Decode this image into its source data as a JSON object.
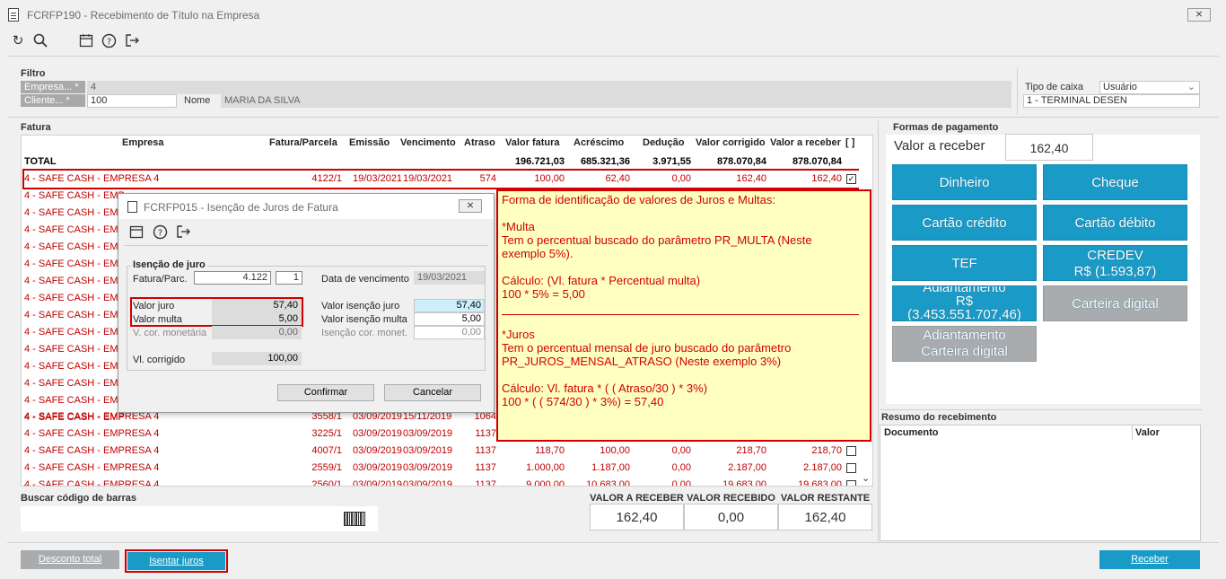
{
  "window": {
    "title": "FCRFP190 - Recebimento de Título na Empresa",
    "close": "⨯"
  },
  "filtro": {
    "section": "Filtro",
    "empresa_label": "Empresa... *",
    "empresa_value": "4",
    "cliente_label": "Cliente... *",
    "cliente_value": "100",
    "nome_label": "Nome",
    "nome_value": "MARIA DA SILVA",
    "tipo_caixa_label": "Tipo de caixa",
    "tipo_caixa_value": "Usuário",
    "terminal_value": "1 - TERMINAL DESEN"
  },
  "fatura": {
    "section": "Fatura",
    "columns": [
      "Empresa",
      "Fatura/Parcela",
      "Emissão",
      "Vencimento",
      "Atraso",
      "Valor fatura",
      "Acréscimo",
      "Dedução",
      "Valor corrigido",
      "Valor a receber",
      "[ ]"
    ],
    "total": {
      "label": "TOTAL",
      "valor_fatura": "196.721,03",
      "acrescimo": "685.321,36",
      "deducao": "3.971,55",
      "valor_corrigido": "878.070,84",
      "valor_receber": "878.070,84"
    },
    "first_row": {
      "empresa": "4 - SAFE CASH -  EMPRESA 4",
      "fatura": "4122/1",
      "emissao": "19/03/2021",
      "vencimento": "19/03/2021",
      "atraso": "574",
      "valor_fatura": "100,00",
      "acrescimo": "62,40",
      "deducao": "0,00",
      "valor_corrigido": "162,40",
      "valor_receber": "162,40",
      "checked": "✓"
    },
    "truncated_rows": [
      "4 - SAFE CASH -  EMP",
      "4 - SAFE CASH -  EMP",
      "4 - SAFE CASH -  EMP",
      "4 - SAFE CASH -  EMP",
      "4 - SAFE CASH -  EMP",
      "4 - SAFE CASH -  EMP",
      "4 - SAFE CASH -  EMP",
      "4 - SAFE CASH -  EMP",
      "4 - SAFE CASH -  EMP",
      "4 - SAFE CASH -  EMP",
      "4 - SAFE CASH -  EMP",
      "4 - SAFE CASH -  EMP",
      "4 - SAFE CASH -  EMP",
      "4 - SAFE CASH -  EMP"
    ],
    "rows": [
      {
        "empresa": "4 - SAFE CASH -  EMPRESA 4",
        "fatura": "3558/1",
        "emissao": "03/09/2019",
        "vencimento": "15/11/2019",
        "atraso": "1064"
      },
      {
        "empresa": "4 - SAFE CASH -  EMPRESA 4",
        "fatura": "3225/1",
        "emissao": "03/09/2019",
        "vencimento": "03/09/2019",
        "atraso": "1137"
      },
      {
        "empresa": "4 - SAFE CASH -  EMPRESA 4",
        "fatura": "4007/1",
        "emissao": "03/09/2019",
        "vencimento": "03/09/2019",
        "atraso": "1137",
        "valor_fatura": "118,70",
        "acrescimo": "100,00",
        "deducao": "0,00",
        "valor_corrigido": "218,70",
        "valor_receber": "218,70"
      },
      {
        "empresa": "4 - SAFE CASH -  EMPRESA 4",
        "fatura": "2559/1",
        "emissao": "03/09/2019",
        "vencimento": "03/09/2019",
        "atraso": "1137",
        "valor_fatura": "1.000,00",
        "acrescimo": "1.187,00",
        "deducao": "0,00",
        "valor_corrigido": "2.187,00",
        "valor_receber": "2.187,00"
      },
      {
        "empresa": "4 - SAFE CASH -  EMPRESA 4",
        "fatura": "2560/1",
        "emissao": "03/09/2019",
        "vencimento": "03/09/2019",
        "atraso": "1137",
        "valor_fatura": "9.000,00",
        "acrescimo": "10.683,00",
        "deducao": "0,00",
        "valor_corrigido": "19.683,00",
        "valor_receber": "19.683,00"
      }
    ]
  },
  "dialog": {
    "title": "FCRFP015 - Isenção de Juros de Fatura",
    "group": "Isenção de juro",
    "fatura_label": "Fatura/Parc.",
    "fatura_value": "4.122",
    "parcela_value": "1",
    "data_venc_label": "Data de vencimento",
    "data_venc_value": "19/03/2021",
    "valor_juro_label": "Valor juro",
    "valor_juro_value": "57,40",
    "valor_multa_label": "Valor multa",
    "valor_multa_value": "5,00",
    "vcor_label": "V. cor. monetária",
    "vcor_value": "0,00",
    "vi_juro_label": "Valor isenção juro",
    "vi_juro_value": "57,40",
    "vi_multa_label": "Valor isenção multa",
    "vi_multa_value": "5,00",
    "icor_label": "Isenção cor. monet.",
    "icor_value": "0,00",
    "vl_corr_label": "Vl. corrigido",
    "vl_corr_value": "100,00",
    "confirmar": "Confirmar",
    "cancelar": "Cancelar"
  },
  "note": {
    "l1": "Forma de identificação de valores de Juros e Multas:",
    "l2": "*Multa",
    "l3": "Tem o percentual buscado do parâmetro PR_MULTA (Neste",
    "l4": "exemplo 5%).",
    "l5": "Cálculo: (Vl. fatura * Percentual multa)",
    "l6": "100 * 5% = 5,00",
    "l7": "*Juros",
    "l8": "Tem o percentual mensal de juro buscado do parâmetro",
    "l9": "PR_JUROS_MENSAL_ATRASO (Neste exemplo 3%)",
    "l10": "Cálculo: Vl. fatura * ( ( Atraso/30 ) * 3%)",
    "l11": "100 * ( ( 574/30 ) * 3%) = 57,40"
  },
  "pagamento": {
    "section": "Formas de pagamento",
    "valor_receber_label": "Valor a receber",
    "valor_receber_value": "162,40",
    "dinheiro": "Dinheiro",
    "cheque": "Cheque",
    "cartao_credito": "Cartão crédito",
    "cartao_debito": "Cartão débito",
    "tef": "TEF",
    "credev_l1": "CREDEV",
    "credev_l2": "R$ (1.593,87)",
    "adiant_l1": "Adiantamento",
    "adiant_l2": "R$",
    "adiant_l3": "(3.453.551.707,46)",
    "carteira_digital": "Carteira digital",
    "adiant_cart_l1": "Adiantamento",
    "adiant_cart_l2": "Carteira digital"
  },
  "resumo": {
    "section": "Resumo do recebimento",
    "col_documento": "Documento",
    "col_valor": "Valor"
  },
  "barcode": {
    "label": "Buscar código de barras"
  },
  "summary": {
    "valor_receber_label": "VALOR A RECEBER",
    "valor_receber": "162,40",
    "valor_recebido_label": "VALOR RECEBIDO",
    "valor_recebido": "0,00",
    "valor_restante_label": "VALOR RESTANTE",
    "valor_restante": "162,40"
  },
  "footer": {
    "desconto_total": "Desconto total",
    "isentar_juros": "Isentar juros",
    "receber": "Receber"
  },
  "colors": {
    "accent": "#1a9bc7",
    "red": "#d00000",
    "note_bg": "#ffffc0"
  }
}
